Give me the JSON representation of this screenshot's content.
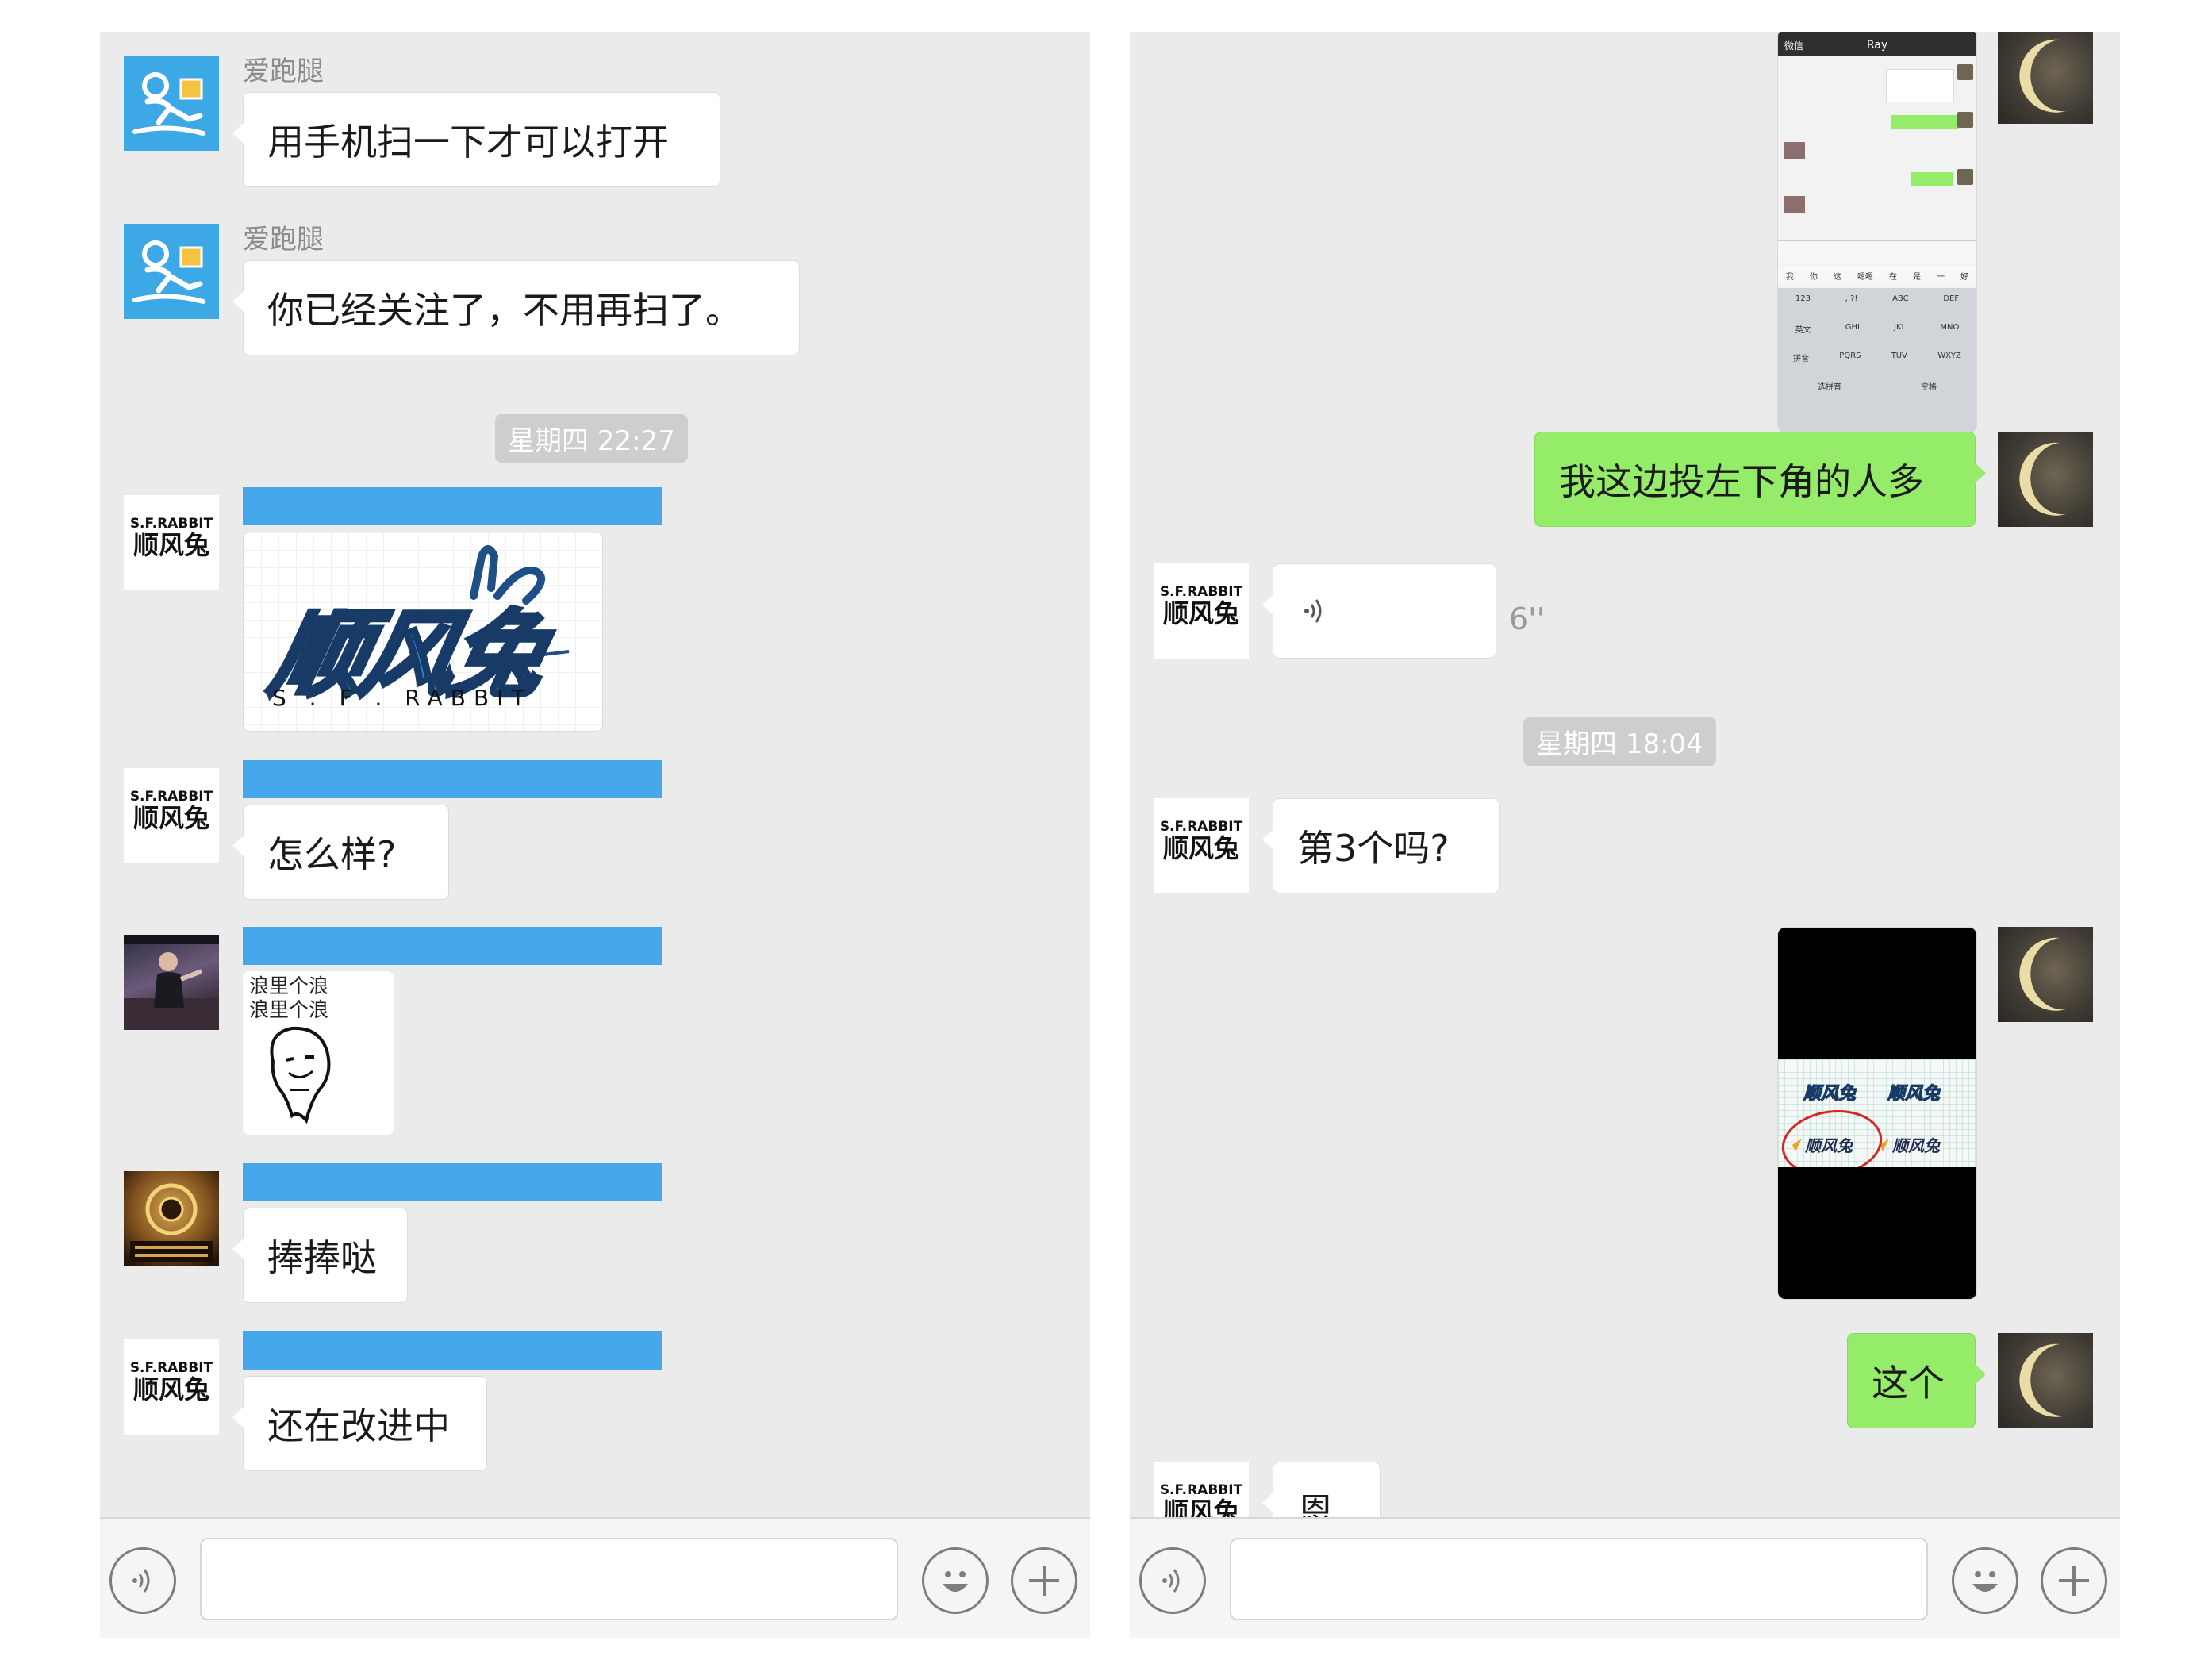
{
  "left_panel": {
    "messages": [
      {
        "sender": "爱跑腿",
        "text": "用手机扫一下才可以打开"
      },
      {
        "sender": "爱跑腿",
        "text": "你已经关注了，不用再扫了。"
      }
    ],
    "timestamp": "星期四 22:27",
    "sfr_logo_card": {
      "brand_cn": "顺风兔",
      "brand_en": "S . F . RABBIT"
    },
    "msg_zenmeyang": "怎么样?",
    "sticker": {
      "line1": "浪里个浪",
      "line2": "浪里个浪"
    },
    "msg_pengpengda": "捧捧哒",
    "msg_haizai": "还在改进中"
  },
  "right_panel": {
    "phone_screenshot": {
      "title": "Ray",
      "back": "微信",
      "kb_candidates": [
        "我",
        "你",
        "这",
        "嗯嗯",
        "在",
        "是",
        "一",
        "好"
      ],
      "kb_row1": [
        "123",
        ",.?!",
        "ABC",
        "DEF"
      ],
      "kb_row2": [
        "英文",
        "GHI",
        "JKL",
        "MNO"
      ],
      "kb_row3": [
        "拼音",
        "PQRS",
        "TUV",
        "WXYZ"
      ],
      "kb_row4": [
        "选拼音",
        "空格"
      ]
    },
    "msg_out_1": "我这边投左下角的人多",
    "voice_duration": "6''",
    "timestamp": "星期四 18:04",
    "msg_di3ge": "第3个吗?",
    "msg_out_2": "这个",
    "msg_en": "恩"
  },
  "avatar": {
    "sfr_en": "S.F.RABBIT",
    "sfr_cn": "顺风兔"
  },
  "colors": {
    "panel_bg": "#ebebeb",
    "outgoing_bubble": "#95ec69",
    "incoming_bubble": "#ffffff",
    "redaction_bar": "#46a8ea",
    "timestamp_bg": "#cecece"
  },
  "icons": [
    "voice-icon",
    "emoji-icon",
    "plus-icon",
    "voice-wave-icon"
  ]
}
